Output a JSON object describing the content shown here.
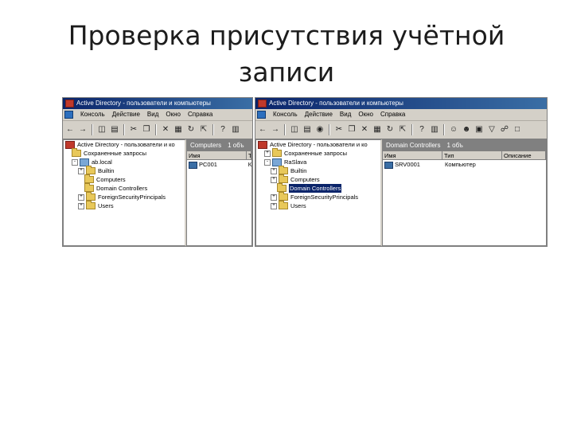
{
  "slide": {
    "title_line1": "Проверка присутствия учётной",
    "title_line2": "записи"
  },
  "left_window": {
    "title": "Active Directory - пользователи и компьютеры",
    "menu": [
      "Консоль",
      "Действие",
      "Вид",
      "Окно",
      "Справка"
    ],
    "tree": {
      "root": "Active Directory - пользователи и ко",
      "saved_queries": "Сохраненные запросы",
      "domain": "ab.local",
      "items": [
        "Builtin",
        "Computers",
        "Domain Controllers",
        "ForeignSecurityPrincipals",
        "Users"
      ],
      "selected": "Computers"
    },
    "list": {
      "header_name": "Computers",
      "header_count": "1 объ",
      "columns": [
        "Имя",
        "Т"
      ],
      "rows": [
        {
          "name": "PC001",
          "type": "К"
        }
      ]
    }
  },
  "right_window": {
    "title": "Active Directory - пользователи и компьютеры",
    "menu": [
      "Консоль",
      "Действие",
      "Вид",
      "Окно",
      "Справка"
    ],
    "tree": {
      "root": "Active Directory - пользователи и ко",
      "saved_queries": "Сохраненные запросы",
      "domain": "RaSlava",
      "items": [
        "Builtin",
        "Computers",
        "Domain Controllers",
        "ForeignSecurityPrincipals",
        "Users"
      ],
      "selected": "Domain Controllers"
    },
    "list": {
      "header_name": "Domain Controllers",
      "header_count": "1 объ",
      "columns": [
        "Имя",
        "Тип",
        "Описание"
      ],
      "rows": [
        {
          "name": "SRV0001",
          "type": "Компьютер",
          "description": ""
        }
      ]
    }
  },
  "icons": [
    "back-arrow-icon",
    "forward-arrow-icon",
    "up-folder-icon",
    "properties-icon",
    "cut-icon",
    "copy-icon",
    "delete-icon",
    "refresh-icon",
    "export-icon",
    "help-icon",
    "user-icon",
    "group-icon",
    "filter-icon",
    "find-icon"
  ]
}
